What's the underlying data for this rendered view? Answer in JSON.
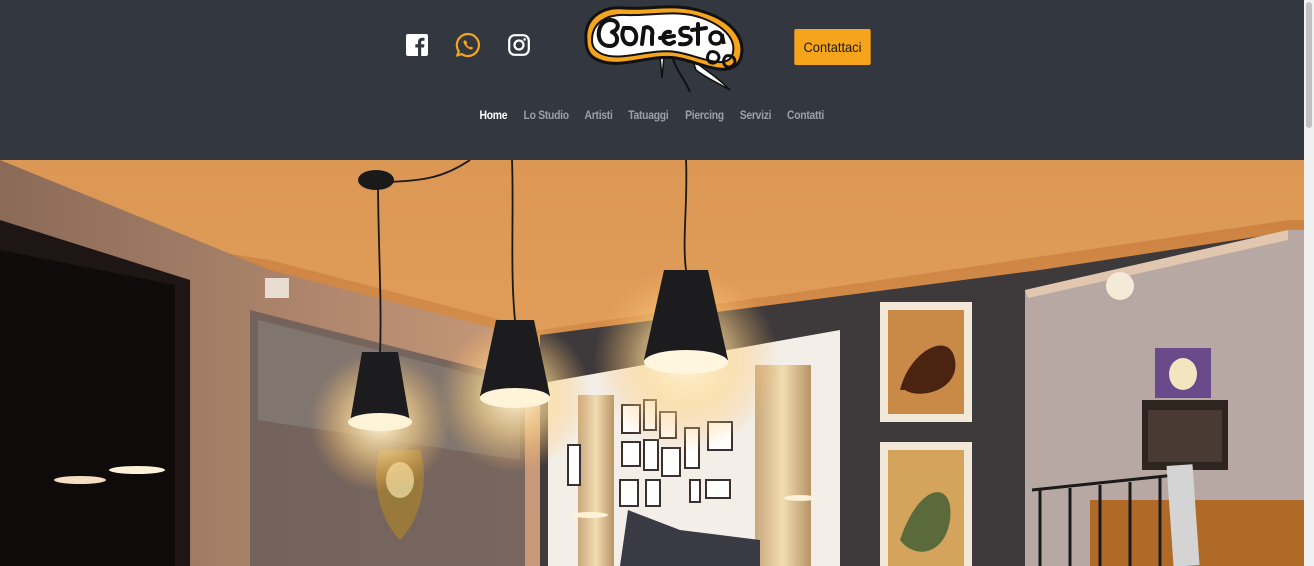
{
  "header": {
    "social": [
      {
        "name": "facebook",
        "icon": "facebook-icon",
        "color": "#ffffff"
      },
      {
        "name": "whatsapp",
        "icon": "whatsapp-icon",
        "color": "#f6a41b"
      },
      {
        "name": "instagram",
        "icon": "instagram-icon",
        "color": "#ffffff"
      }
    ],
    "logo_alt": "Bonestattoo",
    "cta_label": "Contattaci",
    "background": "#333740",
    "accent": "#f6a41b"
  },
  "nav": {
    "items": [
      {
        "label": "Home",
        "active": true
      },
      {
        "label": "Lo Studio",
        "active": false
      },
      {
        "label": "Artisti",
        "active": false
      },
      {
        "label": "Tatuaggi",
        "active": false
      },
      {
        "label": "Piercing",
        "active": false
      },
      {
        "label": "Servizi",
        "active": false
      },
      {
        "label": "Contatti",
        "active": false
      }
    ]
  },
  "hero": {
    "description": "tattoo-studio-interior-photo"
  }
}
